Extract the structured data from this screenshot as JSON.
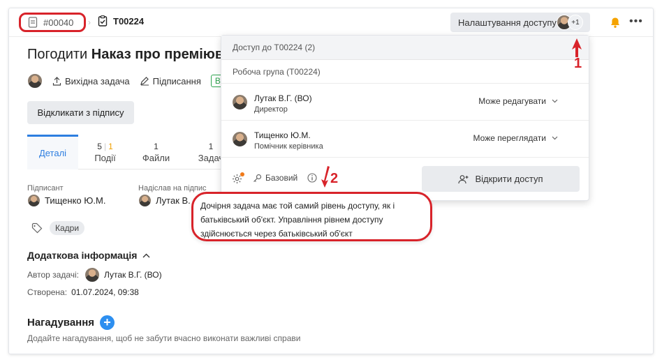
{
  "header": {
    "parent_id": "#00040",
    "current_id": "T00224",
    "access_button_label": "Налаштування доступу",
    "access_extra_count": "+1"
  },
  "task": {
    "title_prefix": "Погодити",
    "title_bold": "Наказ про преміюван",
    "source_task_label": "Вихідна задача",
    "signing_label": "Підписання",
    "status_label": "В р",
    "recall_button": "Відкликати з підпису"
  },
  "tabs": [
    {
      "label": "Деталі",
      "active": true
    },
    {
      "count_a": "5",
      "count_b": "1",
      "label": "Події"
    },
    {
      "count_a": "1",
      "label": "Файли"
    },
    {
      "count_a": "1",
      "label": "Задач"
    }
  ],
  "fields": {
    "signer_label": "Підписант",
    "signer_name": "Тищенко Ю.М.",
    "sent_by_label": "Надіслав на підпис",
    "sent_by_name": "Лутак В."
  },
  "tag": "Кадри",
  "additional": {
    "heading": "Додаткова інформація",
    "author_label": "Автор задачі:",
    "author_name": "Лутак В.Г. (ВО)",
    "created_label": "Створена:",
    "created_value": "01.07.2024, 09:38"
  },
  "reminders": {
    "heading": "Нагадування",
    "subtitle": "Додайте нагадування, щоб не забути вчасно виконати важливі справи"
  },
  "access_panel": {
    "title": "Доступ до T00224 (2)",
    "group": "Робоча група (T00224)",
    "members": [
      {
        "name": "Лутак В.Г. (ВО)",
        "role": "Директор",
        "permission": "Може редагувати"
      },
      {
        "name": "Тищенко Ю.М.",
        "role": "Помічник керівника",
        "permission": "Може переглядати"
      }
    ],
    "level_label": "Базовий",
    "open_access_button": "Відкрити доступ"
  },
  "tooltip": {
    "text": "Дочірня задача має той самий рівень доступу, як і батьківський об'єкт. Управління рівнем доступу здійснюється через батьківський об'єкт"
  },
  "annotations": [
    "1",
    "2"
  ],
  "colors": {
    "accent": "#2d7ee0",
    "highlight_red": "#d8232a",
    "status_green": "#2ea44f"
  }
}
